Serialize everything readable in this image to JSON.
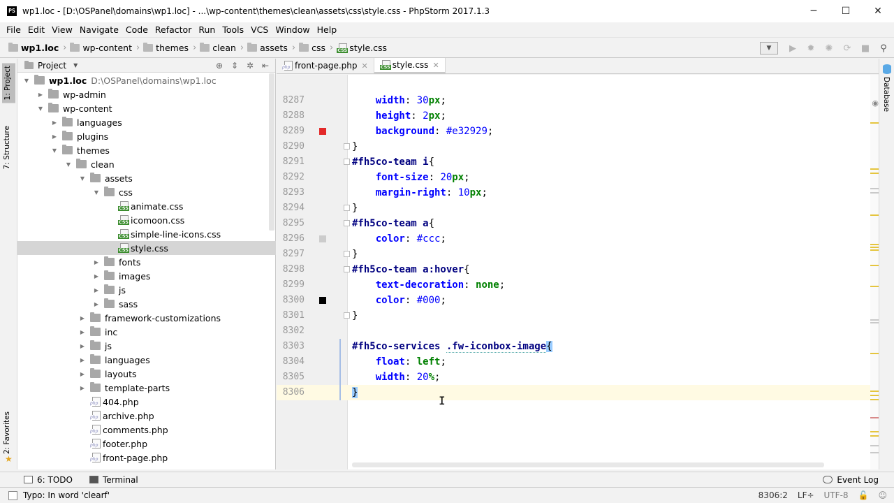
{
  "window": {
    "title": "wp1.loc - [D:\\OSPanel\\domains\\wp1.loc] - ...\\wp-content\\themes\\clean\\assets\\css\\style.css - PhpStorm 2017.1.3",
    "app_icon_text": "PS",
    "minimize": "─",
    "maximize": "☐",
    "close": "✕"
  },
  "menu": [
    "File",
    "Edit",
    "View",
    "Navigate",
    "Code",
    "Refactor",
    "Run",
    "Tools",
    "VCS",
    "Window",
    "Help"
  ],
  "breadcrumb": [
    "wp1.loc",
    "wp-content",
    "themes",
    "clean",
    "assets",
    "css",
    "style.css"
  ],
  "left_strip": {
    "project_tab": "1: Project",
    "structure_tab": "7: Structure",
    "favorites_tab": "2: Favorites"
  },
  "right_strip": {
    "database_tab": "Database"
  },
  "project_panel": {
    "title": "Project",
    "tree": [
      {
        "label": "wp1.loc",
        "path": "D:\\OSPanel\\domains\\wp1.loc",
        "kind": "folder",
        "level": 0,
        "expanded": true,
        "bold": true
      },
      {
        "label": "wp-admin",
        "kind": "folder",
        "level": 1,
        "expanded": false
      },
      {
        "label": "wp-content",
        "kind": "folder",
        "level": 1,
        "expanded": true
      },
      {
        "label": "languages",
        "kind": "folder",
        "level": 2,
        "expanded": false
      },
      {
        "label": "plugins",
        "kind": "folder",
        "level": 2,
        "expanded": false
      },
      {
        "label": "themes",
        "kind": "folder",
        "level": 2,
        "expanded": true
      },
      {
        "label": "clean",
        "kind": "folder",
        "level": 3,
        "expanded": true
      },
      {
        "label": "assets",
        "kind": "folder",
        "level": 4,
        "expanded": true
      },
      {
        "label": "css",
        "kind": "folder",
        "level": 5,
        "expanded": true
      },
      {
        "label": "animate.css",
        "kind": "css",
        "level": 6
      },
      {
        "label": "icomoon.css",
        "kind": "css",
        "level": 6
      },
      {
        "label": "simple-line-icons.css",
        "kind": "css",
        "level": 6
      },
      {
        "label": "style.css",
        "kind": "css",
        "level": 6,
        "selected": true
      },
      {
        "label": "fonts",
        "kind": "folder",
        "level": 5,
        "expanded": false
      },
      {
        "label": "images",
        "kind": "folder",
        "level": 5,
        "expanded": false
      },
      {
        "label": "js",
        "kind": "folder",
        "level": 5,
        "expanded": false
      },
      {
        "label": "sass",
        "kind": "folder",
        "level": 5,
        "expanded": false
      },
      {
        "label": "framework-customizations",
        "kind": "folder",
        "level": 4,
        "expanded": false
      },
      {
        "label": "inc",
        "kind": "folder",
        "level": 4,
        "expanded": false
      },
      {
        "label": "js",
        "kind": "folder",
        "level": 4,
        "expanded": false
      },
      {
        "label": "languages",
        "kind": "folder",
        "level": 4,
        "expanded": false
      },
      {
        "label": "layouts",
        "kind": "folder",
        "level": 4,
        "expanded": false
      },
      {
        "label": "template-parts",
        "kind": "folder",
        "level": 4,
        "expanded": false
      },
      {
        "label": "404.php",
        "kind": "php",
        "level": 4
      },
      {
        "label": "archive.php",
        "kind": "php",
        "level": 4
      },
      {
        "label": "comments.php",
        "kind": "php",
        "level": 4
      },
      {
        "label": "footer.php",
        "kind": "php",
        "level": 4
      },
      {
        "label": "front-page.php",
        "kind": "php",
        "level": 4
      }
    ]
  },
  "editor_tabs": [
    {
      "label": "front-page.php",
      "kind": "php",
      "active": false,
      "close": "✕"
    },
    {
      "label": "style.css",
      "kind": "css",
      "active": true,
      "close": "✕"
    }
  ],
  "code_lines": [
    {
      "num": "8287",
      "html_tokens": [
        [
          "    ",
          ""
        ],
        [
          "width",
          "prop"
        ],
        [
          ": ",
          "punct"
        ],
        [
          "30",
          "num"
        ],
        [
          "px",
          "unit"
        ],
        [
          ";",
          "punct"
        ]
      ]
    },
    {
      "num": "8288",
      "html_tokens": [
        [
          "    ",
          ""
        ],
        [
          "height",
          "prop"
        ],
        [
          ": ",
          "punct"
        ],
        [
          "2",
          "num"
        ],
        [
          "px",
          "unit"
        ],
        [
          ";",
          "punct"
        ]
      ]
    },
    {
      "num": "8289",
      "swatch": "#e32929",
      "html_tokens": [
        [
          "    ",
          ""
        ],
        [
          "background",
          "prop"
        ],
        [
          ": ",
          "punct"
        ],
        [
          "#e32929",
          "num"
        ],
        [
          ";",
          "punct"
        ]
      ]
    },
    {
      "num": "8290",
      "fold": true,
      "html_tokens": [
        [
          "}",
          "punct"
        ]
      ]
    },
    {
      "num": "8291",
      "fold": true,
      "html_tokens": [
        [
          "#fh5co-team i",
          "sel"
        ],
        [
          "{",
          "punct"
        ]
      ]
    },
    {
      "num": "8292",
      "html_tokens": [
        [
          "    ",
          ""
        ],
        [
          "font-size",
          "prop"
        ],
        [
          ": ",
          "punct"
        ],
        [
          "20",
          "num"
        ],
        [
          "px",
          "unit"
        ],
        [
          ";",
          "punct"
        ]
      ]
    },
    {
      "num": "8293",
      "html_tokens": [
        [
          "    ",
          ""
        ],
        [
          "margin-right",
          "prop"
        ],
        [
          ": ",
          "punct"
        ],
        [
          "10",
          "num"
        ],
        [
          "px",
          "unit"
        ],
        [
          ";",
          "punct"
        ]
      ]
    },
    {
      "num": "8294",
      "fold": true,
      "html_tokens": [
        [
          "}",
          "punct"
        ]
      ]
    },
    {
      "num": "8295",
      "fold": true,
      "html_tokens": [
        [
          "#fh5co-team a",
          "sel"
        ],
        [
          "{",
          "punct"
        ]
      ]
    },
    {
      "num": "8296",
      "swatch": "#cccccc",
      "html_tokens": [
        [
          "    ",
          ""
        ],
        [
          "color",
          "prop"
        ],
        [
          ": ",
          "punct"
        ],
        [
          "#ccc",
          "num"
        ],
        [
          ";",
          "punct"
        ]
      ]
    },
    {
      "num": "8297",
      "fold": true,
      "html_tokens": [
        [
          "}",
          "punct"
        ]
      ]
    },
    {
      "num": "8298",
      "fold": true,
      "html_tokens": [
        [
          "#fh5co-team a:hover",
          "sel"
        ],
        [
          "{",
          "punct"
        ]
      ]
    },
    {
      "num": "8299",
      "html_tokens": [
        [
          "    ",
          ""
        ],
        [
          "text-decoration",
          "prop"
        ],
        [
          ": ",
          "punct"
        ],
        [
          "none",
          "val"
        ],
        [
          ";",
          "punct"
        ]
      ]
    },
    {
      "num": "8300",
      "swatch": "#000000",
      "html_tokens": [
        [
          "    ",
          ""
        ],
        [
          "color",
          "prop"
        ],
        [
          ": ",
          "punct"
        ],
        [
          "#000",
          "num"
        ],
        [
          ";",
          "punct"
        ]
      ]
    },
    {
      "num": "8301",
      "fold": true,
      "html_tokens": [
        [
          "}",
          "punct"
        ]
      ]
    },
    {
      "num": "8302",
      "html_tokens": []
    },
    {
      "num": "8303",
      "modified": true,
      "html_tokens": [
        [
          "#fh5co-services ",
          "sel"
        ],
        [
          ".fw-iconbox-image",
          "sel dashed"
        ],
        [
          "{",
          "brace-hl"
        ]
      ]
    },
    {
      "num": "8304",
      "modified": true,
      "html_tokens": [
        [
          "    ",
          ""
        ],
        [
          "float",
          "prop"
        ],
        [
          ": ",
          "punct"
        ],
        [
          "left",
          "val"
        ],
        [
          ";",
          "punct"
        ]
      ]
    },
    {
      "num": "8305",
      "modified": true,
      "html_tokens": [
        [
          "    ",
          ""
        ],
        [
          "width",
          "prop"
        ],
        [
          ": ",
          "punct"
        ],
        [
          "20",
          "num"
        ],
        [
          "%",
          "unit"
        ],
        [
          ";",
          "punct"
        ]
      ]
    },
    {
      "num": "8306",
      "current": true,
      "modified": true,
      "html_tokens": [
        [
          "}",
          "caret-box"
        ]
      ]
    }
  ],
  "bottom_tools": {
    "todo": "6: TODO",
    "terminal": "Terminal",
    "event_log": "Event Log"
  },
  "status": {
    "message": "Typo: In word 'clearf'",
    "position": "8306:2",
    "line_sep": "LF÷",
    "encoding": "UTF-8"
  }
}
